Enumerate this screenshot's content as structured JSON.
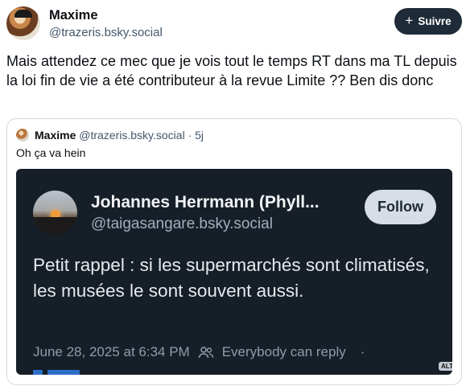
{
  "post": {
    "author_name": "Maxime",
    "author_handle": "@trazeris.bsky.social",
    "follow_label": "Suivre",
    "follow_icon": "plus-icon",
    "text": "Mais attendez ce mec que je vois tout le temps RT dans ma TL depuis la loi fin de vie a été contributeur à la revue Limite ?? Ben dis donc"
  },
  "quote": {
    "author_name": "Maxime",
    "author_handle": "@trazeris.bsky.social",
    "separator": "·",
    "age": "5j",
    "text": "Oh ça va hein",
    "image": {
      "author_name": "Johannes Herrmann (Phyll...",
      "author_handle": "@taigasangare.bsky.social",
      "follow_label": "Follow",
      "text": "Petit rappel : si les supermarchés sont climatisés, les musées le sont souvent aussi.",
      "date": "June 28, 2025 at 6:34 PM",
      "reply_setting": "Everybody can reply",
      "trailing_dot": "·",
      "alt_badge": "ALT"
    }
  },
  "colors": {
    "follow_button_bg": "#1f2b38",
    "embed_bg": "#161e27",
    "handle_gray": "#42576c"
  }
}
